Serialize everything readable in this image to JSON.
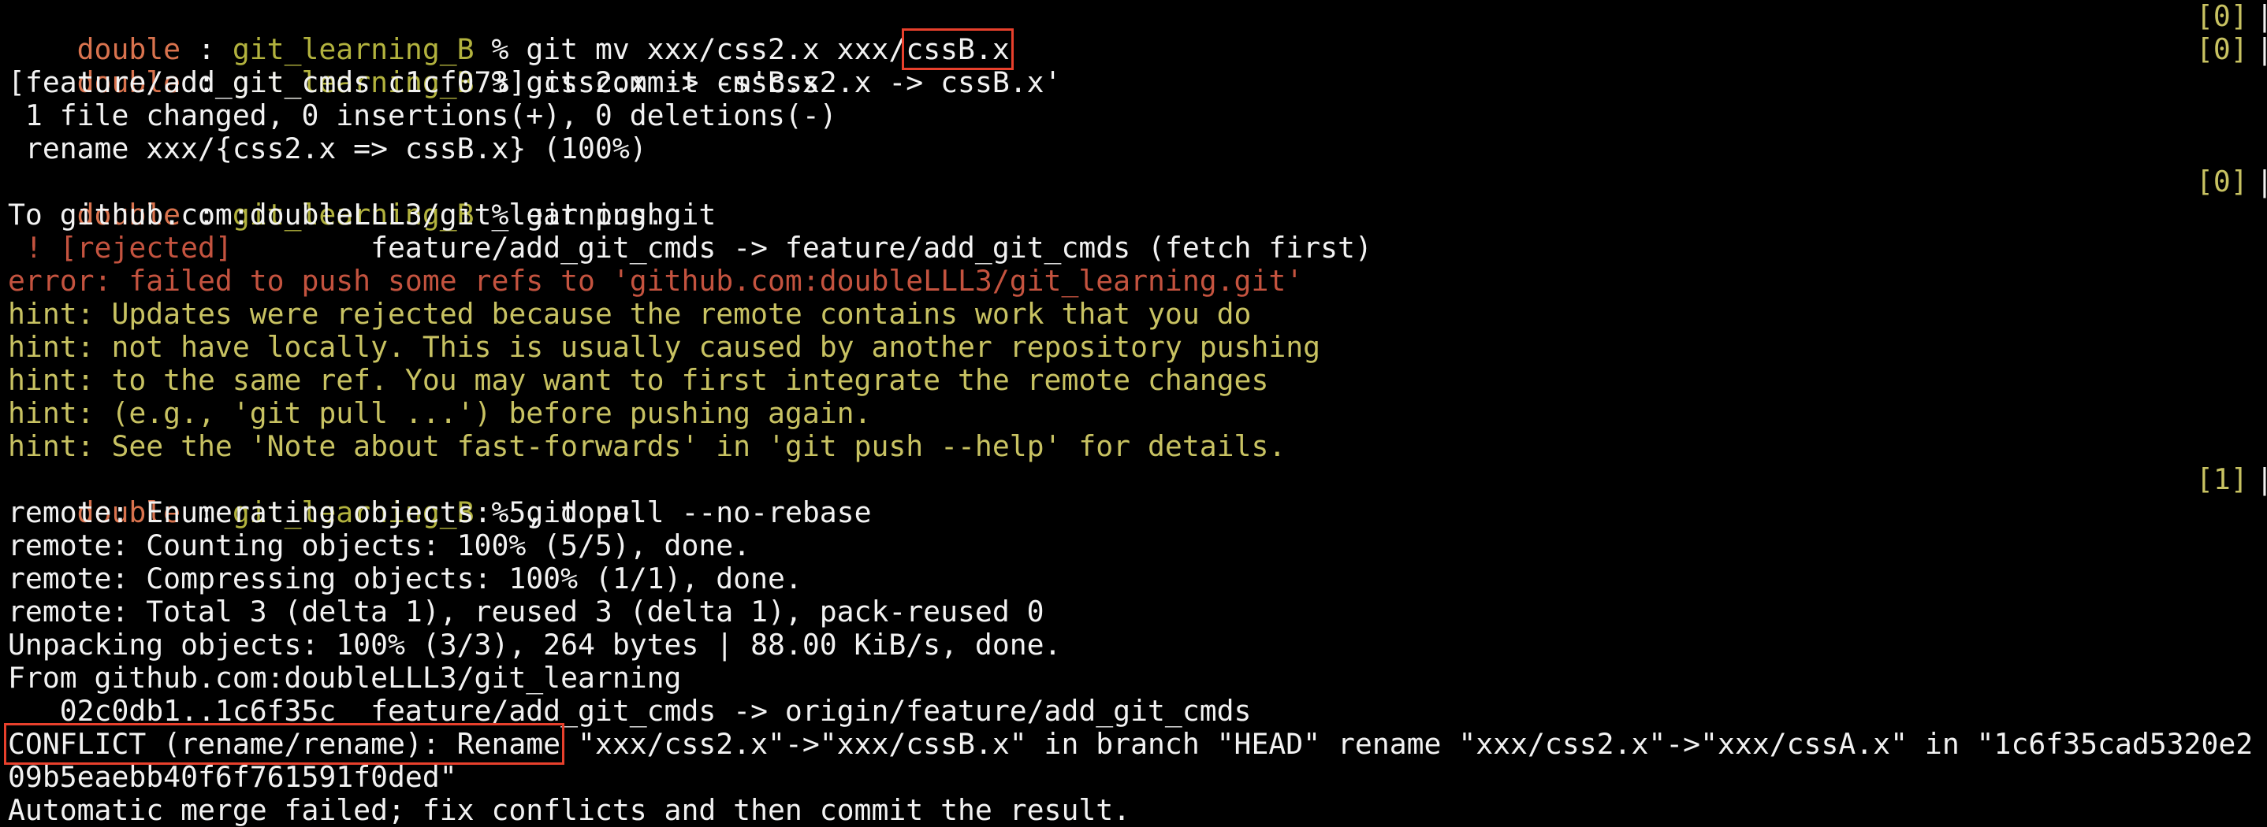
{
  "prompt": {
    "user": "double",
    "sep": " : ",
    "repo": "git_learning_B",
    "symbol": " % "
  },
  "lines": {
    "l1_cmd_before": "git mv xxx/css2.x xxx/",
    "l1_cmd_boxed": "cssB.x",
    "l1_status": "[0]",
    "l2_cmd": "git commit -m'css2.x -> cssB.x'",
    "l2_status": "[0]",
    "l3": "[feature/add_git_cmds c1cf073] css2.x -> cssB.x",
    "l4": " 1 file changed, 0 insertions(+), 0 deletions(-)",
    "l5": " rename xxx/{css2.x => cssB.x} (100%)",
    "l6_cmd": "git push",
    "l6_status": "[0]",
    "l7": "To github.com:doubleLLL3/git_learning.git",
    "l8_rejected": " ! [rejected]",
    "l8_rest": "        feature/add_git_cmds -> feature/add_git_cmds (fetch first)",
    "l9": "error: failed to push some refs to 'github.com:doubleLLL3/git_learning.git'",
    "l10": "hint: Updates were rejected because the remote contains work that you do",
    "l11": "hint: not have locally. This is usually caused by another repository pushing",
    "l12": "hint: to the same ref. You may want to first integrate the remote changes",
    "l13": "hint: (e.g., 'git pull ...') before pushing again.",
    "l14": "hint: See the 'Note about fast-forwards' in 'git push --help' for details.",
    "l15_cmd": "git pull --no-rebase",
    "l15_status": "[1]",
    "l16": "remote: Enumerating objects: 5, done.",
    "l17": "remote: Counting objects: 100% (5/5), done.",
    "l18": "remote: Compressing objects: 100% (1/1), done.",
    "l19": "remote: Total 3 (delta 1), reused 3 (delta 1), pack-reused 0",
    "l20": "Unpacking objects: 100% (3/3), 264 bytes | 88.00 KiB/s, done.",
    "l21": "From github.com:doubleLLL3/git_learning",
    "l22": "   02c0db1..1c6f35c  feature/add_git_cmds -> origin/feature/add_git_cmds",
    "l23_boxed": "CONFLICT (rename/rename): Rename",
    "l23_rest": " \"xxx/css2.x\"->\"xxx/cssB.x\" in branch \"HEAD\" rename \"xxx/css2.x\"->\"xxx/cssA.x\" in \"1c6f35cad5320e2",
    "l24": "09b5eaebb40f6f761591f0ded\"",
    "l25": "Automatic merge failed; fix conflicts and then commit the result."
  },
  "right_edge": "|",
  "colors": {
    "background": "#000000",
    "text": "#f2f2f2",
    "prompt_user": "#d9734e",
    "prompt_repo": "#b2b23e",
    "hint": "#c8c262",
    "error": "#c4533f",
    "highlight_box": "#e8402c"
  }
}
